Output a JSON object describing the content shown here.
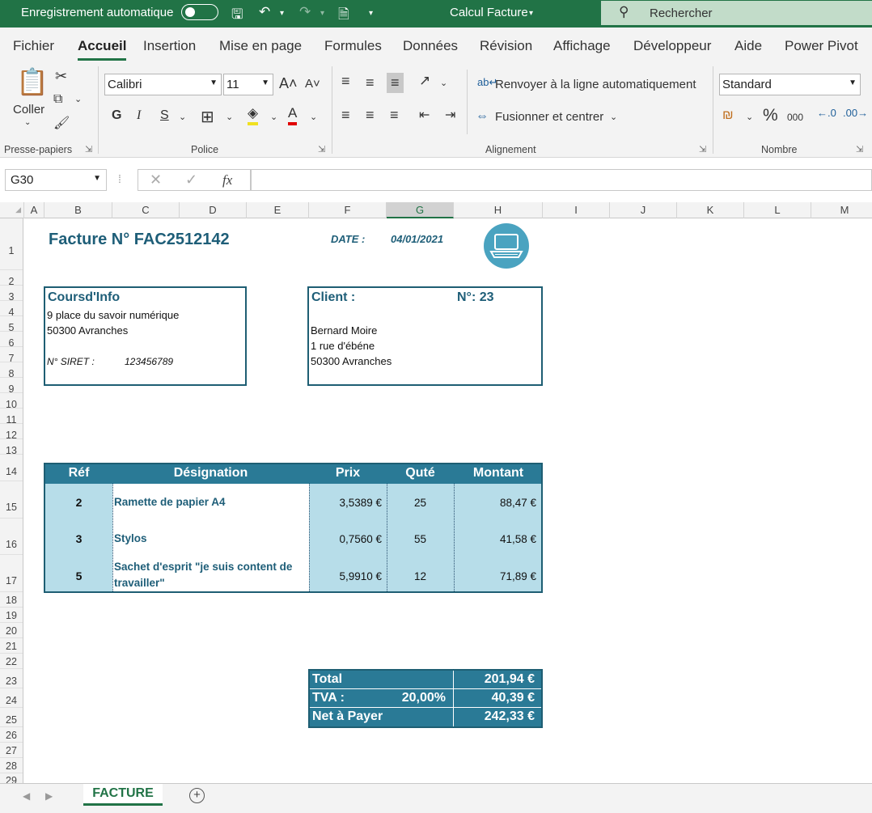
{
  "titlebar": {
    "autosave": "Enregistrement automatique",
    "doc_title": "Calcul Facture",
    "search": "Rechercher"
  },
  "menu": [
    "Fichier",
    "Accueil",
    "Insertion",
    "Mise en page",
    "Formules",
    "Données",
    "Révision",
    "Affichage",
    "Développeur",
    "Aide",
    "Power Pivot"
  ],
  "ribbon": {
    "paste": "Coller",
    "font_name": "Calibri",
    "font_size": "11",
    "bold": "G",
    "italic": "I",
    "underline": "S",
    "wrap": "Renvoyer à la ligne automatiquement",
    "merge": "Fusionner et centrer",
    "number_format": "Standard",
    "thousands": "000",
    "groups": {
      "clipboard": "Presse-papiers",
      "font": "Police",
      "alignment": "Alignement",
      "number": "Nombre"
    }
  },
  "formula_bar": {
    "name_box": "G30",
    "formula": ""
  },
  "columns": [
    "A",
    "B",
    "C",
    "D",
    "E",
    "F",
    "G",
    "H",
    "I",
    "J",
    "K",
    "L",
    "M"
  ],
  "selected_column": "G",
  "rows": [
    "1",
    "2",
    "3",
    "4",
    "5",
    "6",
    "7",
    "8",
    "9",
    "10",
    "11",
    "12",
    "13",
    "14",
    "15",
    "16",
    "17",
    "18",
    "19",
    "20",
    "21",
    "22",
    "23",
    "24",
    "25",
    "26",
    "27",
    "28",
    "29"
  ],
  "invoice": {
    "title": "Facture N° FAC2512142",
    "date_label": "DATE :",
    "date": "04/01/2021",
    "seller": {
      "name": "Coursd'Info",
      "address1": "9 place du savoir numérique",
      "address2": "50300 Avranches",
      "siret_label": "N° SIRET :",
      "siret": "123456789"
    },
    "client": {
      "label": "Client :",
      "number": "N°: 23",
      "name": "Bernard Moire",
      "address1": "1 rue d'ébéne",
      "address2": "50300 Avranches"
    },
    "headers": {
      "ref": "Réf",
      "designation": "Désignation",
      "prix": "Prix",
      "qte": "Quté",
      "montant": "Montant"
    },
    "items": [
      {
        "ref": "2",
        "designation": "Ramette de papier A4",
        "prix": "3,5389 €",
        "qte": "25",
        "montant": "88,47 €"
      },
      {
        "ref": "3",
        "designation": "Stylos",
        "prix": "0,7560 €",
        "qte": "55",
        "montant": "41,58 €"
      },
      {
        "ref": "5",
        "designation": "Sachet d'esprit \"je suis content de travailler\"",
        "prix": "5,9910 €",
        "qte": "12",
        "montant": "71,89 €"
      }
    ],
    "totals": {
      "total_label": "Total",
      "total": "201,94 €",
      "tva_label": "TVA :",
      "tva_rate": "20,00%",
      "tva": "40,39 €",
      "net_label": "Net à Payer",
      "net": "242,33 €"
    }
  },
  "sheet_tab": "FACTURE",
  "colors": {
    "excel_green": "#217346",
    "invoice_blue": "#2a7a96",
    "light_blue": "#b7dde9",
    "title_blue": "#1e5e78"
  }
}
